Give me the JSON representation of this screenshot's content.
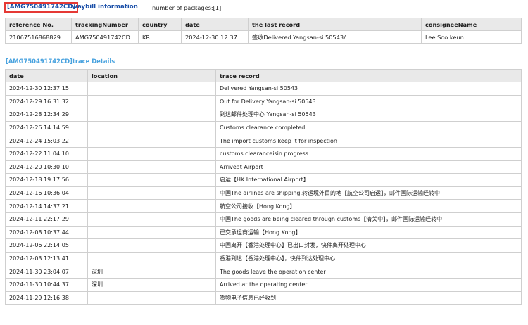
{
  "header": {
    "tracking_code": "[AMG750491742CD]",
    "title": "waybill information",
    "package_count": "number of packages:[1]"
  },
  "waybill": {
    "columns": [
      "reference No.",
      "trackingNumber",
      "country",
      "date",
      "the last record",
      "consigneeName"
    ],
    "row": [
      "210675168688297...",
      "AMG750491742CD",
      "KR",
      "2024-12-30 12:37:...",
      "签收Delivered Yangsan-si 50543/",
      "Lee Soo keun"
    ]
  },
  "trace": {
    "title": "[AMG750491742CD]trace Details",
    "columns": [
      "date",
      "location",
      "trace record"
    ],
    "rows": [
      [
        "2024-12-30 12:37:15",
        "",
        "Delivered Yangsan-si 50543"
      ],
      [
        "2024-12-29 16:31:32",
        "",
        "Out for Delivery Yangsan-si 50543"
      ],
      [
        "2024-12-28 12:34:29",
        "",
        "到达邮件处理中心 Yangsan-si 50543"
      ],
      [
        "2024-12-26 14:14:59",
        "",
        "Customs clearance completed"
      ],
      [
        "2024-12-24 15:03:22",
        "",
        "The import customs keep it for inspection"
      ],
      [
        "2024-12-22 11:04:10",
        "",
        "customs clearanceisin progress"
      ],
      [
        "2024-12-20 10:30:10",
        "",
        "Arriveat Airport"
      ],
      [
        "2024-12-18 19:17:56",
        "",
        "启运【HK International Airport】"
      ],
      [
        "2024-12-16 10:36:04",
        "",
        "中国The airlines are shipping,转运境外目的地【航空公司启运】，邮件国际运输经转中"
      ],
      [
        "2024-12-14 14:37:21",
        "",
        "航空公司接收【Hong Kong】"
      ],
      [
        "2024-12-11 22:17:29",
        "",
        "中国The goods are being cleared through customs【清关中】，邮件国际运输经转中"
      ],
      [
        "2024-12-08 10:37:44",
        "",
        "已交承运商运输【Hong Kong】"
      ],
      [
        "2024-12-06 22:14:05",
        "",
        "中国离开【香港处理中心】已出口封发，快件离开处理中心"
      ],
      [
        "2024-12-03 12:13:41",
        "",
        "香港到达【香港处理中心】，快件到达处理中心"
      ],
      [
        "2024-11-30 23:04:07",
        "深圳",
        "The goods leave the operation center"
      ],
      [
        "2024-11-30 10:44:37",
        "深圳",
        "Arrived at the operating center"
      ],
      [
        "2024-11-29 12:16:38",
        "",
        "货物电子信息已经收到"
      ]
    ]
  }
}
